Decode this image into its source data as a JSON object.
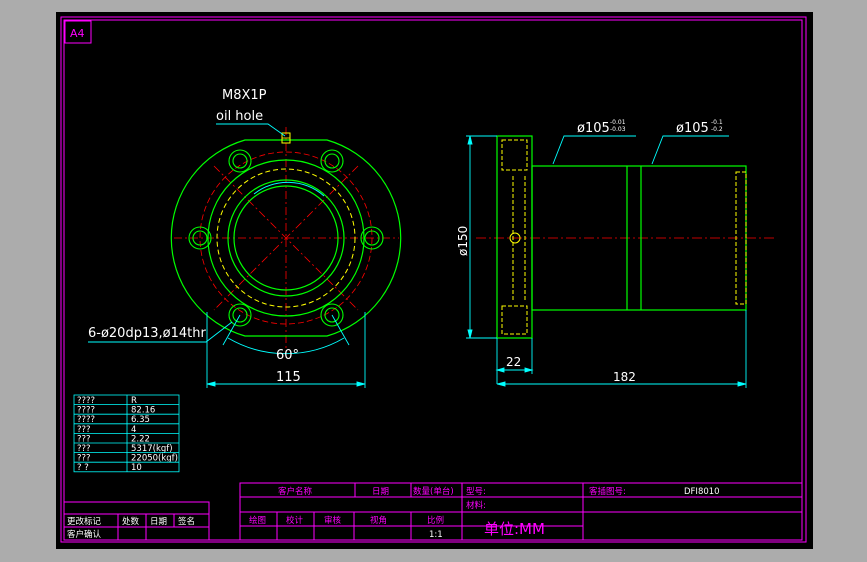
{
  "sheet": {
    "size_label": "A4"
  },
  "colors": {
    "background": "#000000",
    "frame": "#ff00ff",
    "outline": "#00ff00",
    "hidden": "#ffff00",
    "centerline": "#ff0000",
    "dimension": "#00ffff",
    "text": "#ffffff",
    "titleblock_text": "#ff00ff"
  },
  "front_view": {
    "oil_hole_thread": "M8X1P",
    "oil_hole_label": "oil hole",
    "mounting_holes": "6-ø20dp13,ø14thr",
    "angle": "60°",
    "pcd_dimension": "115"
  },
  "side_view": {
    "flange_diameter": "ø150",
    "body_diameter_1": "ø105",
    "body_tol_1_upper": "-0.01",
    "body_tol_1_lower": "-0.03",
    "body_diameter_2": "ø105",
    "body_tol_2_upper": "-0.1",
    "body_tol_2_lower": "-0.2",
    "flange_thickness": "22",
    "total_length": "182"
  },
  "spec_table": {
    "rows": [
      {
        "label": "????",
        "value": "R"
      },
      {
        "label": "????",
        "value": "82.16"
      },
      {
        "label": "????",
        "value": "6.35"
      },
      {
        "label": "???",
        "value": "4"
      },
      {
        "label": "???",
        "value": "2.22"
      },
      {
        "label": "???",
        "value": "5317(kgf)"
      },
      {
        "label": "???",
        "value": "22050(kgf)"
      },
      {
        "label": "?  ?",
        "value": "10"
      }
    ]
  },
  "revision_block": {
    "headers": [
      "更改标记",
      "处数",
      "日期",
      "签名"
    ],
    "customer_confirm": "客户确认"
  },
  "title_block": {
    "customer_name": "客户名称",
    "date": "日期",
    "quantity": "数量(单台)",
    "model": "型号:",
    "spec_drawing_no_label": "客插图号:",
    "spec_drawing_no": "DFI8010",
    "material": "材料:",
    "drawn": "绘图",
    "design": "校计",
    "review": "审核",
    "approve": "视角",
    "scale_label": "比例",
    "scale_value": "1:1",
    "unit": "单位:MM"
  }
}
